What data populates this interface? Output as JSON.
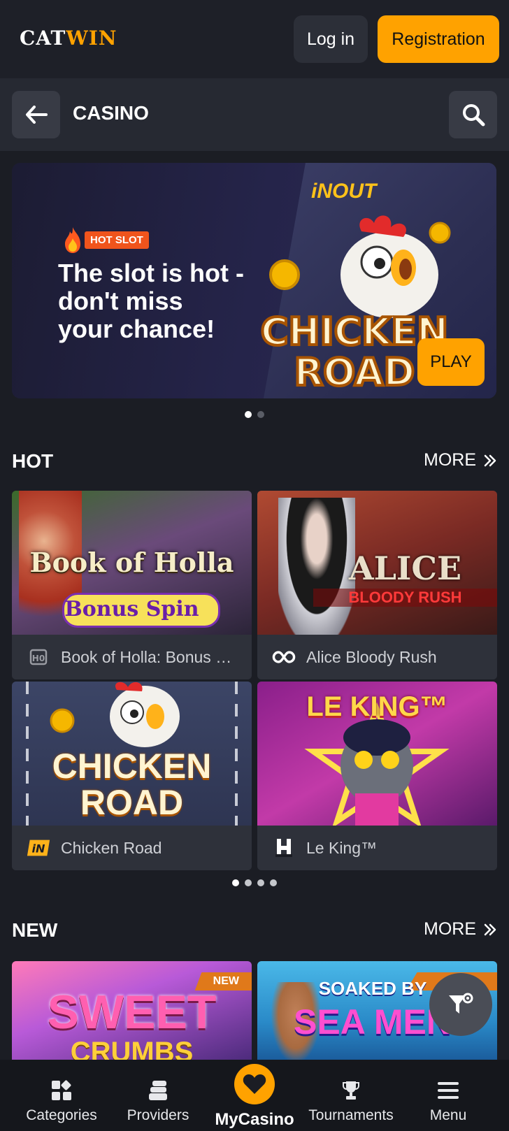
{
  "header": {
    "logo_part1": "CAT",
    "logo_part2": "WIN",
    "login_label": "Log in",
    "registration_label": "Registration"
  },
  "subbar": {
    "title": "CASINO"
  },
  "banner": {
    "badge": "HOT SLOT",
    "headline_line1": "The slot is hot -",
    "headline_line2": "don't miss",
    "headline_line3": "your chance!",
    "provider_logo": "iNOUT",
    "game_logo_line1": "CHICKEN",
    "game_logo_line2": "ROAD",
    "play_label": "PLAY",
    "slides_total": 2,
    "slide_active": 1
  },
  "hot": {
    "title": "HOT",
    "more_label": "MORE",
    "pages_total": 4,
    "page_active": 1,
    "games": [
      {
        "name": "Book of Holla: Bonus Spin",
        "thumb_title": "Book of Holla",
        "thumb_sub": "Bonus Spin",
        "provider_icon": "hacksaw-icon"
      },
      {
        "name": "Alice Bloody Rush",
        "thumb_title": "ALICE",
        "thumb_sub": "BLOODY RUSH",
        "provider_icon": "infinity-provider-icon"
      },
      {
        "name": "Chicken Road",
        "thumb_title": "CHICKEN",
        "thumb_sub": "ROAD",
        "provider_icon": "inout-provider-icon"
      },
      {
        "name": "Le King™",
        "thumb_title": "LE KING™",
        "thumb_sub": "",
        "provider_icon": "hacksaw-h-icon"
      }
    ]
  },
  "new": {
    "title": "NEW",
    "more_label": "MORE",
    "games": [
      {
        "tag": "NEW",
        "thumb_title": "SWEET",
        "thumb_sub": "CRUMBS"
      },
      {
        "tag": "",
        "thumb_title": "SOAKED BY",
        "thumb_sub": "SEA MEN"
      }
    ]
  },
  "bottom_nav": {
    "items": [
      {
        "label": "Categories",
        "icon": "categories-icon"
      },
      {
        "label": "Providers",
        "icon": "providers-icon"
      },
      {
        "label": "MyCasino",
        "icon": "heart-icon"
      },
      {
        "label": "Tournaments",
        "icon": "trophy-icon"
      },
      {
        "label": "Menu",
        "icon": "menu-icon"
      }
    ]
  },
  "colors": {
    "accent": "#ffa200",
    "background": "#1b1d24",
    "card": "#2e313a"
  }
}
